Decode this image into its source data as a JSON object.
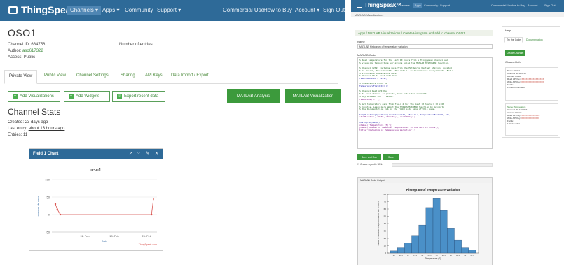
{
  "left": {
    "brand": "ThingSpeak™",
    "nav": [
      {
        "label": "Channels ▾",
        "active": true
      },
      {
        "label": "Apps ▾",
        "active": false
      },
      {
        "label": "Community",
        "active": false
      },
      {
        "label": "Support ▾",
        "active": false
      },
      {
        "label": "Commercial Use",
        "active": false
      },
      {
        "label": "How to Buy",
        "active": false
      },
      {
        "label": "Account ▾",
        "active": false
      },
      {
        "label": "Sign Out",
        "active": false
      }
    ],
    "title": "OSO1",
    "channel_id_label": "Channel ID:",
    "channel_id": "684756",
    "author_label": "Author:",
    "author": "aso617322",
    "access": "Access: Public",
    "num_entries": "Number of entries",
    "tabs": [
      "Private View",
      "Public View",
      "Channel Settings",
      "Sharing",
      "API Keys",
      "Data Import / Export"
    ],
    "buttons": {
      "add_vis": "Add Visualizations",
      "add_widgets": "Add Widgets",
      "export": "Export recent data",
      "matlab_analysis": "MATLAB Analysis",
      "matlab_vis": "MATLAB Visualization"
    },
    "stats_title": "Channel Stats",
    "created_label": "Created:",
    "created": "23 days ago",
    "last_entry_label": "Last entry:",
    "last_entry": "about 13 hours ago",
    "entries": "Entries: 11",
    "widget": {
      "title": "Field 1 Chart",
      "icons": [
        "external-link",
        "comment",
        "edit",
        "close"
      ]
    }
  },
  "chart_data": {
    "type": "line",
    "title": "oso1",
    "xlabel": "Date",
    "ylabel": "numero de caso",
    "x_ticks": [
      "11. Feb",
      "18. Feb",
      "25. Feb"
    ],
    "y_ticks": [
      -50,
      0,
      50,
      100
    ],
    "ylim": [
      -50,
      100
    ],
    "series": [
      {
        "name": "",
        "x": [
          0,
          0.02,
          0.05,
          0.98,
          1.0
        ],
        "y": [
          30,
          15,
          0,
          0,
          45
        ]
      }
    ],
    "credit": "ThingSpeak.com",
    "color": "#d9534f"
  },
  "right": {
    "brand": "ThingSpeak™",
    "nav": [
      {
        "label": "Channels",
        "active": false
      },
      {
        "label": "Apps",
        "active": true
      },
      {
        "label": "Community",
        "active": false
      },
      {
        "label": "Support",
        "active": false
      },
      {
        "label": "Commercial Use",
        "active": false
      },
      {
        "label": "How to Buy",
        "active": false
      },
      {
        "label": "Account",
        "active": false
      },
      {
        "label": "Sign Out",
        "active": false
      }
    ],
    "crumb": "MATLAB Visualizations",
    "heading": "Apps / MATLAB Visualizations / Create Histogram and add to channel OSO1",
    "name_label": "Name",
    "name_value": "MATLAB Histogram of temperature variation",
    "code_label": "MATLAB Code",
    "code": [
      {
        "t": "% Read temperature for the last 10 hours from a ThingSpeak channel and",
        "c": ""
      },
      {
        "t": "% visualize temperature variations using the MATLAB HISTOGRAM function.",
        "c": ""
      },
      {
        "t": "",
        "c": ""
      },
      {
        "t": "% Channel 12397 contains data from the MathWorks Weather Station, located",
        "c": ""
      },
      {
        "t": "% in Natick, Massachusetts. The data is collected once every minute. Field",
        "c": ""
      },
      {
        "t": "% 4 contains temperature data.",
        "c": ""
      },
      {
        "t": "% Channel ID to read data from",
        "c": ""
      },
      {
        "t": "readChannelID = 12397;",
        "c": "k"
      },
      {
        "t": "",
        "c": ""
      },
      {
        "t": "% Temperature Field ID",
        "c": ""
      },
      {
        "t": "TemperatureFieldID = 4;",
        "c": "k"
      },
      {
        "t": "",
        "c": ""
      },
      {
        "t": "% Channel Read API Key",
        "c": ""
      },
      {
        "t": "% If your channel is private, then enter the read API",
        "c": ""
      },
      {
        "t": "% Key between the '' below:",
        "c": ""
      },
      {
        "t": "readAPIKey = '';",
        "c": "p"
      },
      {
        "t": "",
        "c": ""
      },
      {
        "t": "% Get temperature data from field 4 for the last 10 hours = 10 x 60",
        "c": ""
      },
      {
        "t": "% minutes. Learn more about the THINGSPEAKREAD function by going to",
        "c": ""
      },
      {
        "t": "% the Documentation tab on the right side pane of this page.",
        "c": ""
      },
      {
        "t": "",
        "c": ""
      },
      {
        "t": "tempF = thingSpeakRead(readChannelID, 'Fields', TemperatureFieldID, 'N',",
        "c": "k"
      },
      {
        "t": "    'NumMinutes', 10*60, 'ReadKey', readAPIKey);",
        "c": "p"
      },
      {
        "t": "",
        "c": ""
      },
      {
        "t": "histogram(tempF);",
        "c": "k"
      },
      {
        "t": "xlabel('Temperature (F)');",
        "c": "p"
      },
      {
        "t": "ylabel('Number of Measured Temperatures in the last 10 hours');",
        "c": "p"
      },
      {
        "t": "title('Histogram of Temperature Variation');",
        "c": "p"
      }
    ],
    "save_run": "Save and Run",
    "save": "Save",
    "create_public": "Create a public URL",
    "output_title": "MATLAB Code Output",
    "side": {
      "title": "Help",
      "tabs": [
        "Try the Code",
        "Documentation"
      ],
      "button": "Create Channel",
      "channel_info_title": "Channel Info",
      "channel_a": [
        {
          "t": "Name: OSO1",
          "r": ""
        },
        {
          "t": "Channel ID: 684756",
          "r": ""
        },
        {
          "t": "Access: Public",
          "r": ""
        },
        {
          "t": "Read API Key: ",
          "r": "XXXXXXXXXXXXXXXX"
        },
        {
          "t": "Write API Key: ",
          "r": "XXXXXXXXXXXXXXXX"
        },
        {
          "t": "Fields:",
          "r": ""
        },
        {
          "t": "  1: numero de caso",
          "r": ""
        }
      ],
      "channel_b_title": "Name: Temperature",
      "channel_b": [
        {
          "t": "Channel ID: 1234567",
          "r": ""
        },
        {
          "t": "Access: Private",
          "r": ""
        },
        {
          "t": "Read API Key: ",
          "r": "XXXXXXXXXXXXX"
        },
        {
          "t": "Write API Key: ",
          "r": "XXXXXXXXXXXXX"
        },
        {
          "t": "Fields:",
          "r": ""
        },
        {
          "t": "  1: Field Label 1",
          "r": ""
        }
      ]
    }
  },
  "histogram_data": {
    "type": "bar",
    "title": "Histogram of Temperature Variation",
    "xlabel": "Temperature (F)",
    "ylabel": "Number of Measured Temperatures in the last 10 hours",
    "categories": [
      "36",
      "36.5",
      "37",
      "37.5",
      "38",
      "38.5",
      "39",
      "39.5",
      "40",
      "40.5",
      "41",
      "41.5"
    ],
    "values": [
      3,
      8,
      14,
      24,
      38,
      62,
      75,
      58,
      34,
      18,
      8,
      4
    ],
    "ylim": [
      0,
      80
    ],
    "y_ticks": [
      0,
      10,
      20,
      30,
      40,
      50,
      60,
      70,
      80
    ],
    "color": "#4a90c8"
  }
}
